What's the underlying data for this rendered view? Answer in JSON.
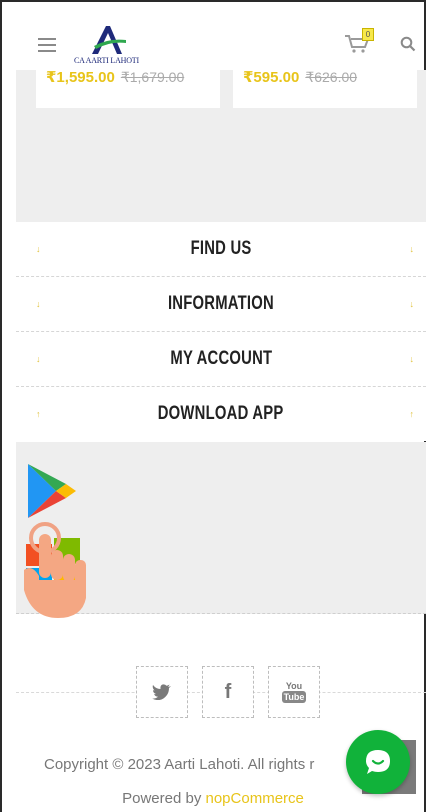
{
  "header": {
    "brand": "CA AARTI LAHOTI",
    "cart_count": "0"
  },
  "products": [
    {
      "price": "₹1,595.00",
      "old_price": "₹1,679.00"
    },
    {
      "price": "₹595.00",
      "old_price": "₹626.00"
    }
  ],
  "accordion": [
    {
      "title": "FIND US"
    },
    {
      "title": "INFORMATION"
    },
    {
      "title": "MY ACCOUNT"
    },
    {
      "title": "DOWNLOAD APP"
    }
  ],
  "social": {
    "twitter": "twitter-icon",
    "facebook": "f",
    "youtube_top": "You",
    "youtube_bottom": "Tube"
  },
  "footer": {
    "copyright": "Copyright © 2023 Aarti Lahoti. All rights r",
    "powered_prefix": "Powered by ",
    "powered_link": "nopCommerce"
  },
  "colors": {
    "accent": "#e8c41a",
    "chat": "#11b23a"
  }
}
